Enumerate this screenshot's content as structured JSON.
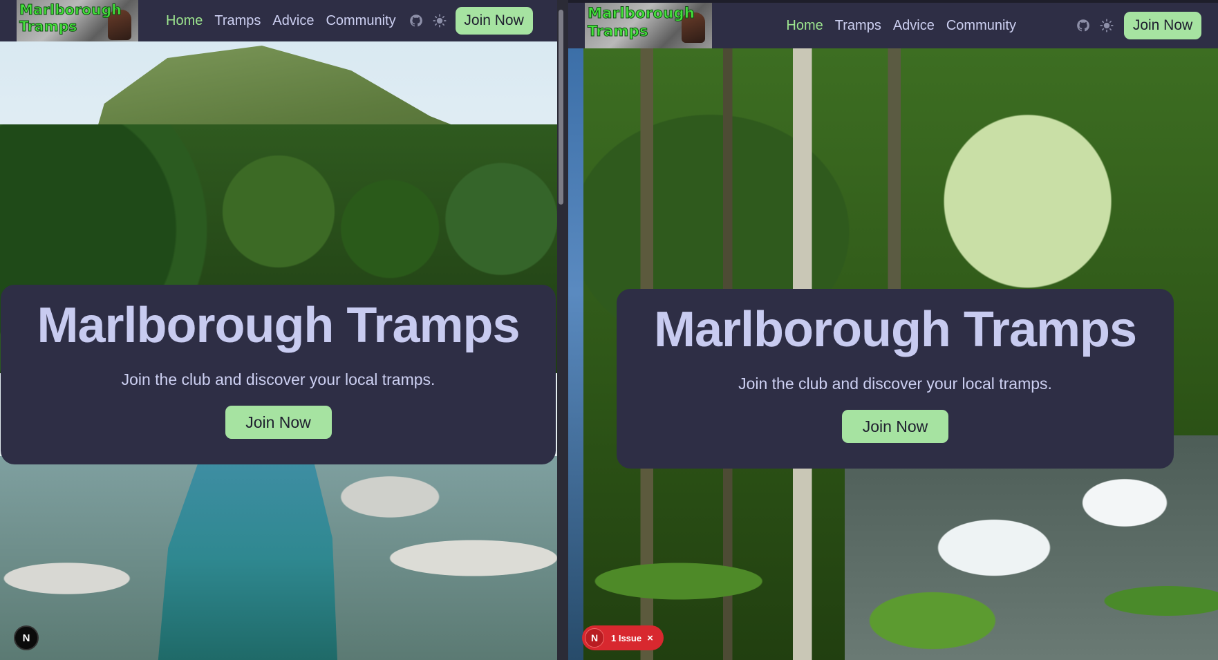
{
  "left_pane": {
    "logo_text": [
      "Marlborough",
      "Tramps"
    ],
    "nav": {
      "links": [
        "Home",
        "Tramps",
        "Advice",
        "Community"
      ],
      "active": "Home",
      "join_label": "Join Now"
    },
    "hero": {
      "title": "Marlborough Tramps",
      "subtitle": "Join the club and discover your local tramps.",
      "join_label": "Join Now"
    },
    "dev_badge": "N"
  },
  "right_pane": {
    "logo_text": [
      "Marlborough",
      "Tramps"
    ],
    "nav": {
      "links": [
        "Home",
        "Tramps",
        "Advice",
        "Community"
      ],
      "active": "Home",
      "join_label": "Join Now"
    },
    "hero": {
      "title": "Marlborough Tramps",
      "subtitle": "Join the club and discover your local tramps.",
      "join_label": "Join Now"
    },
    "issue_badge": {
      "letter": "N",
      "text": "1 Issue",
      "close": "×"
    }
  },
  "icons": [
    "github-icon",
    "sun-icon",
    "close-icon"
  ],
  "colors": {
    "navbar_bg": "#2e2e45",
    "nav_text": "#cdd0f2",
    "nav_active": "#9de58f",
    "button_bg": "#a6e3a1",
    "button_text": "#1e1e2e",
    "hero_title": "#c8cbf0",
    "issue_badge": "#d8282f"
  }
}
